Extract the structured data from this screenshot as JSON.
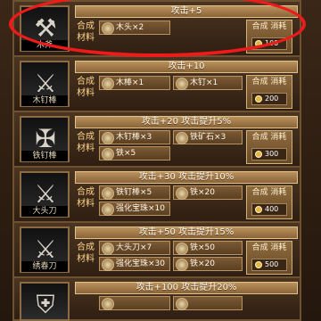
{
  "rows": [
    {
      "item_name": "木斧",
      "title": "攻击+5",
      "label1": "合成",
      "label2": "材料",
      "materials": [
        "木头×2"
      ],
      "cost_title": "合成 消耗",
      "price": "100"
    },
    {
      "item_name": "木钉棒",
      "title": "攻击+10",
      "label1": "合成",
      "label2": "材料",
      "materials": [
        "木棒×1",
        "木钉×1"
      ],
      "cost_title": "合成 消耗",
      "price": "200"
    },
    {
      "item_name": "铁钉棒",
      "title": "攻击+20 攻击提升5%",
      "label1": "合成",
      "label2": "材料",
      "materials": [
        "木钉棒×3",
        "铁矿石×3",
        "铁×5"
      ],
      "cost_title": "合成 消耗",
      "price": "300"
    },
    {
      "item_name": "大头刀",
      "title": "攻击+30 攻击提升10%",
      "label1": "合成",
      "label2": "材料",
      "materials": [
        "铁钉棒×5",
        "铁×20",
        "强化宝珠×10"
      ],
      "cost_title": "合成 消耗",
      "price": "400"
    },
    {
      "item_name": "绣春刀",
      "title": "攻击+50 攻击提升15%",
      "label1": "合成",
      "label2": "材料",
      "materials": [
        "大头刀×7",
        "铁×50",
        "强化宝珠×30",
        "铁×20"
      ],
      "cost_title": "合成 消耗",
      "price": "500"
    },
    {
      "item_name": "",
      "title": "攻击+100 攻击提升20%",
      "label1": "",
      "label2": "",
      "materials": [
        "",
        ""
      ],
      "cost_title": "",
      "price": ""
    }
  ]
}
